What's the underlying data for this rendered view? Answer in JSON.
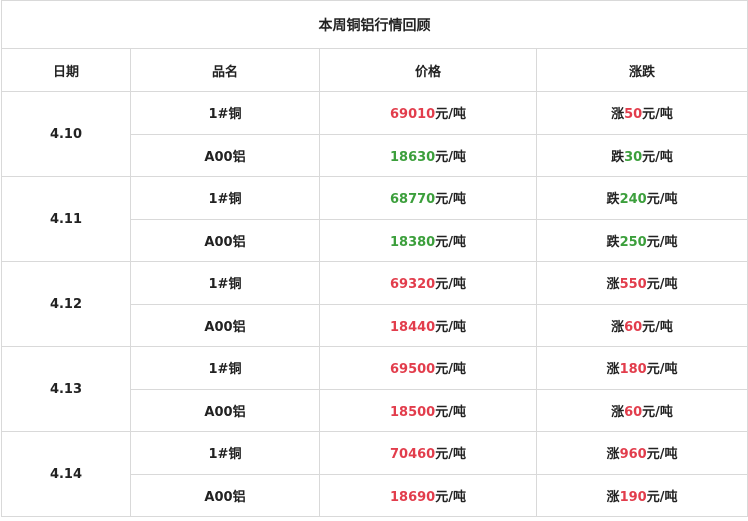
{
  "title": "本周铜铝行情回顾",
  "columns": [
    "日期",
    "品名",
    "价格",
    "涨跌"
  ],
  "unit": "元/吨",
  "colors": {
    "up": "#e23d4c",
    "down": "#3c9f3c"
  },
  "days": [
    {
      "date": "4.10",
      "items": [
        {
          "name": "1#铜",
          "price": "69010",
          "price_dir": "up",
          "change_word": "涨",
          "change": "50"
        },
        {
          "name": "A00铝",
          "price": "18630",
          "price_dir": "down",
          "change_word": "跌",
          "change": "30"
        }
      ]
    },
    {
      "date": "4.11",
      "items": [
        {
          "name": "1#铜",
          "price": "68770",
          "price_dir": "down",
          "change_word": "跌",
          "change": "240"
        },
        {
          "name": "A00铝",
          "price": "18380",
          "price_dir": "down",
          "change_word": "跌",
          "change": "250"
        }
      ]
    },
    {
      "date": "4.12",
      "items": [
        {
          "name": "1#铜",
          "price": "69320",
          "price_dir": "up",
          "change_word": "涨",
          "change": "550"
        },
        {
          "name": "A00铝",
          "price": "18440",
          "price_dir": "up",
          "change_word": "涨",
          "change": "60"
        }
      ]
    },
    {
      "date": "4.13",
      "items": [
        {
          "name": "1#铜",
          "price": "69500",
          "price_dir": "up",
          "change_word": "涨",
          "change": "180"
        },
        {
          "name": "A00铝",
          "price": "18500",
          "price_dir": "up",
          "change_word": "涨",
          "change": "60"
        }
      ]
    },
    {
      "date": "4.14",
      "items": [
        {
          "name": "1#铜",
          "price": "70460",
          "price_dir": "up",
          "change_word": "涨",
          "change": "960"
        },
        {
          "name": "A00铝",
          "price": "18690",
          "price_dir": "up",
          "change_word": "涨",
          "change": "190"
        }
      ]
    }
  ]
}
